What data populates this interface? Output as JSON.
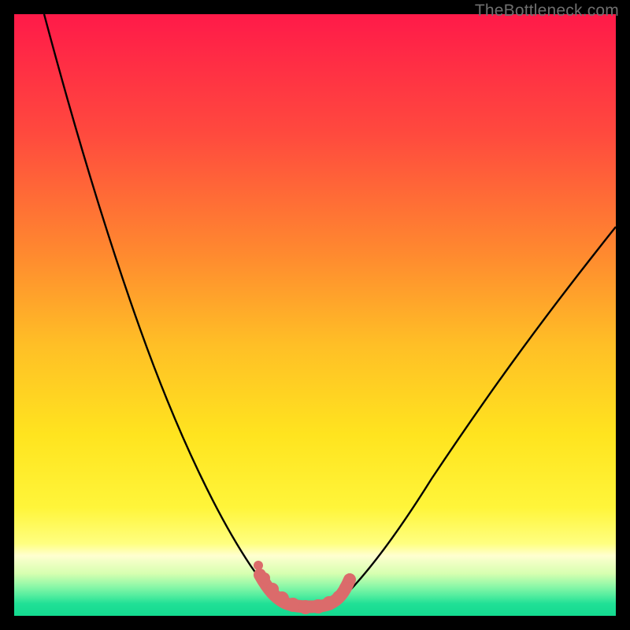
{
  "watermark": {
    "text": "TheBottleneck.com"
  },
  "chart_data": {
    "type": "line",
    "title": "",
    "xlabel": "",
    "ylabel": "",
    "xlim": [
      0,
      100
    ],
    "ylim": [
      0,
      100
    ],
    "grid": false,
    "legend": false,
    "series": [
      {
        "name": "curve-left",
        "color": "#000000",
        "x": [
          5,
          8,
          10,
          12,
          14,
          16,
          18,
          20,
          22,
          24,
          26,
          28,
          30,
          32,
          34,
          36,
          38,
          40,
          41,
          42,
          43
        ],
        "y": [
          100,
          92,
          87,
          82,
          77,
          72,
          66,
          60,
          55,
          49,
          43,
          37,
          32,
          27,
          22,
          17,
          12,
          7,
          5,
          3,
          2
        ]
      },
      {
        "name": "curve-right",
        "color": "#000000",
        "x": [
          52,
          54,
          56,
          58,
          60,
          63,
          66,
          70,
          74,
          78,
          82,
          86,
          90,
          94,
          98,
          100
        ],
        "y": [
          2,
          3,
          5,
          7,
          9,
          12,
          15,
          20,
          25,
          31,
          37,
          43,
          49,
          55,
          62,
          65
        ]
      },
      {
        "name": "dot-markers",
        "color": "#db6b6b",
        "type": "scatter",
        "x": [
          40,
          41,
          42,
          43,
          44,
          45,
          46,
          47,
          48,
          49,
          50,
          51,
          52,
          53,
          54
        ],
        "y": [
          8,
          6,
          4,
          3,
          2,
          2,
          2,
          2,
          2,
          2,
          2,
          3,
          4,
          6,
          8
        ]
      }
    ],
    "background": {
      "type": "vertical-gradient",
      "stops": [
        {
          "pos": 0.0,
          "color": "#ff1a49"
        },
        {
          "pos": 0.2,
          "color": "#ff4a3e"
        },
        {
          "pos": 0.4,
          "color": "#ff8a2f"
        },
        {
          "pos": 0.55,
          "color": "#ffbf26"
        },
        {
          "pos": 0.7,
          "color": "#ffe41f"
        },
        {
          "pos": 0.82,
          "color": "#fff53a"
        },
        {
          "pos": 0.88,
          "color": "#ffff80"
        },
        {
          "pos": 0.9,
          "color": "#ffffd0"
        },
        {
          "pos": 0.93,
          "color": "#d6ffb0"
        },
        {
          "pos": 0.95,
          "color": "#90f8a8"
        },
        {
          "pos": 0.965,
          "color": "#58eea0"
        },
        {
          "pos": 0.98,
          "color": "#20e096"
        },
        {
          "pos": 1.0,
          "color": "#13d98f"
        }
      ]
    }
  }
}
